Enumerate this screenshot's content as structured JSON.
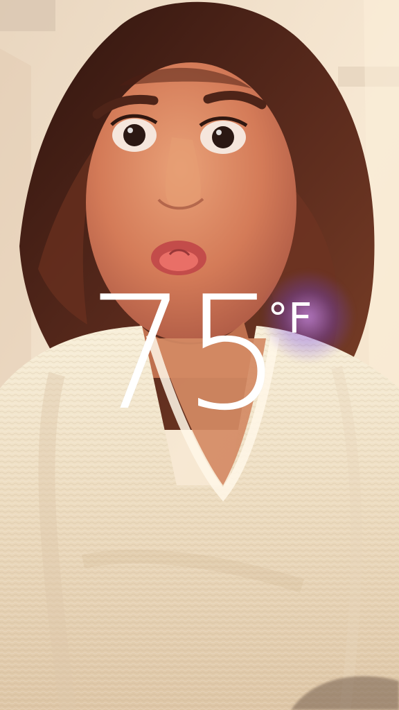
{
  "overlay": {
    "temperature_value": "75",
    "temperature_unit": "°F"
  },
  "icons": {
    "photo_icon": "selfie-photo-icon",
    "flare_icon": "lens-flare-icon"
  },
  "colors": {
    "overlay_text": "#ffffff",
    "warm_wall": "#f2dcbf",
    "sweater": "#f1e4cb",
    "hair": "#4b2418",
    "flare": "#a66cff"
  }
}
